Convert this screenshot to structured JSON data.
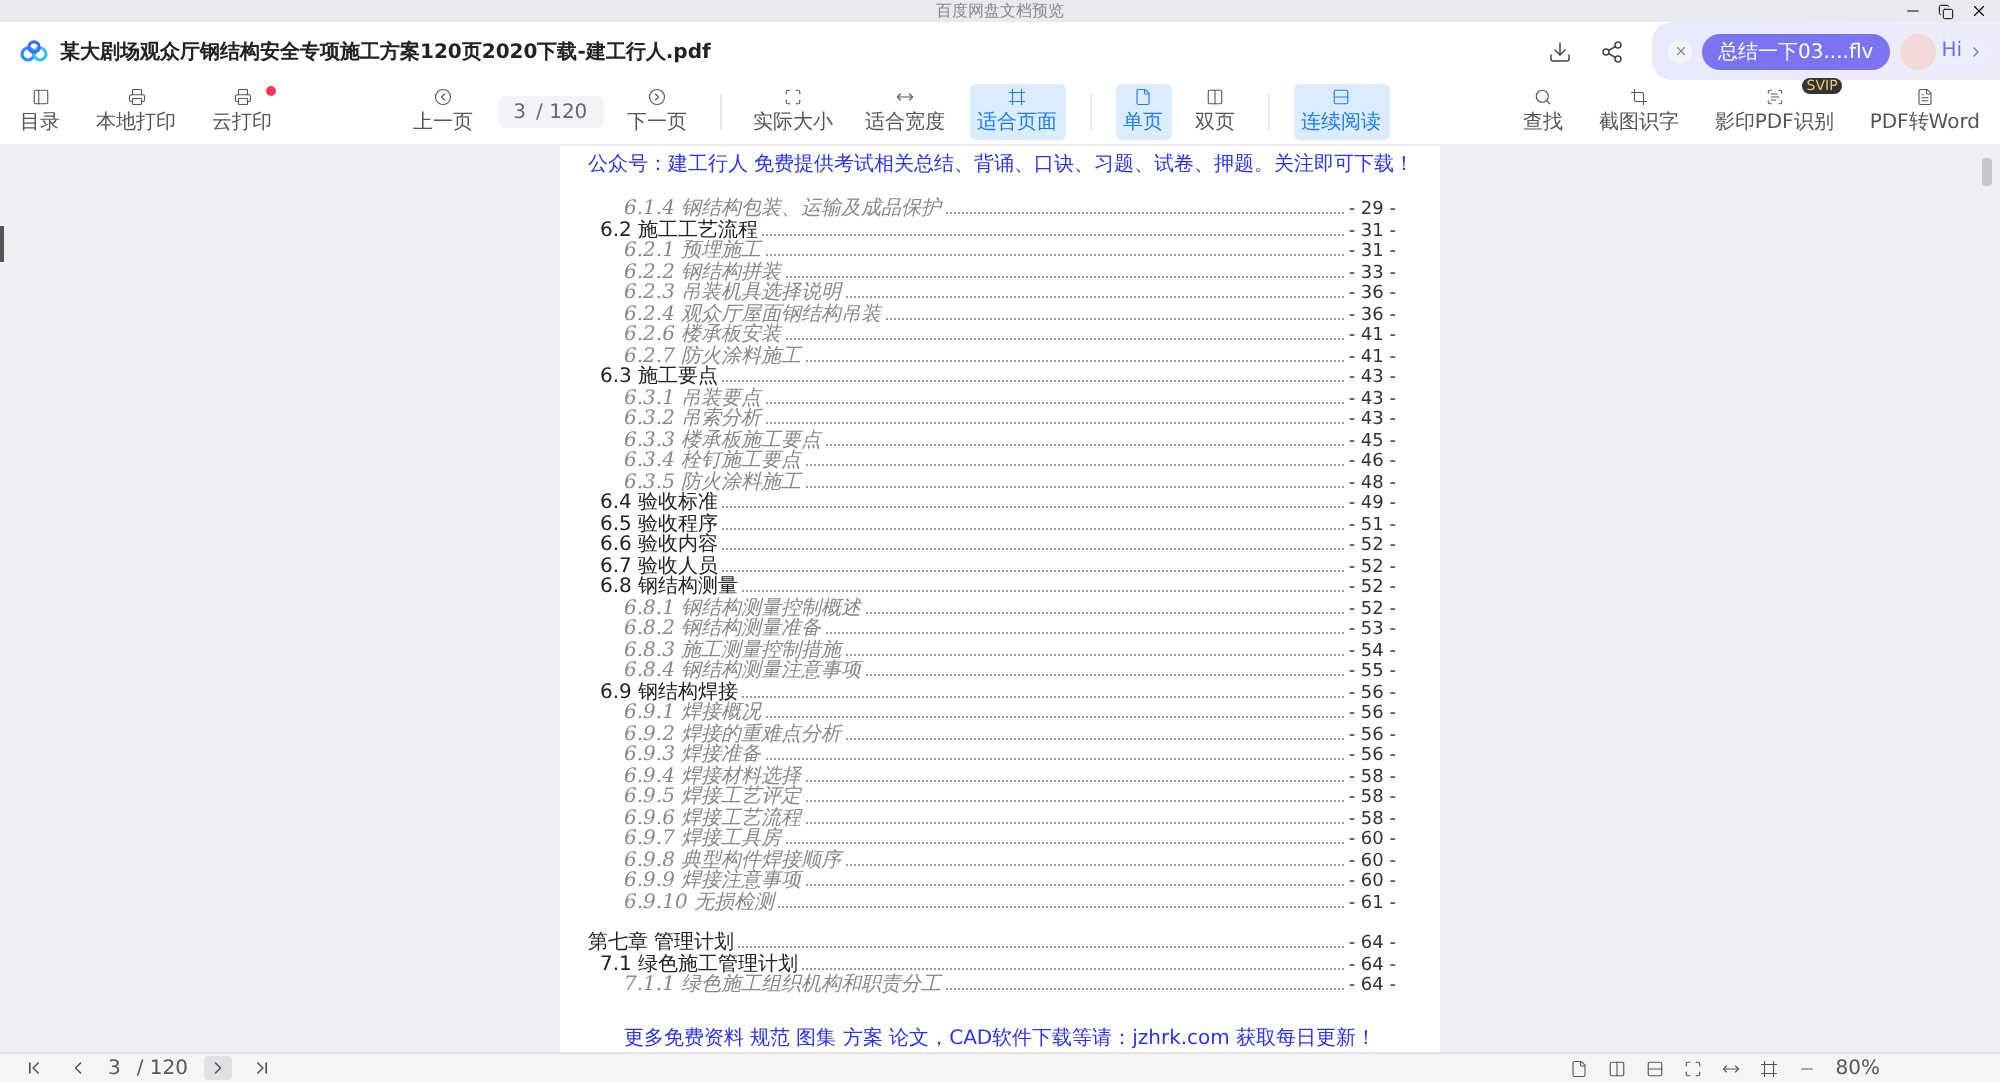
{
  "window": {
    "title": "百度网盘文档预览"
  },
  "file": {
    "name": "某大剧场观众厅钢结构安全专项施工方案120页2020下载-建工行人.pdf"
  },
  "assistant": {
    "suggestion": "总结一下03....flv",
    "greeting": "Hi"
  },
  "toolbar_left": [
    {
      "label": "目录",
      "notification": false
    },
    {
      "label": "本地打印",
      "notification": false
    },
    {
      "label": "云打印",
      "notification": true
    }
  ],
  "page_nav": {
    "previous": "上一页",
    "current": "3",
    "total": "/ 120",
    "next": "下一页"
  },
  "view_buttons": [
    {
      "label": "实际大小",
      "selected": false
    },
    {
      "label": "适合宽度",
      "selected": false
    },
    {
      "label": "适合页面",
      "selected": true
    },
    {
      "label": "单页",
      "selected": true
    },
    {
      "label": "双页",
      "selected": false
    },
    {
      "label": "连续阅读",
      "selected": true
    }
  ],
  "tools_right": [
    {
      "label": "查找"
    },
    {
      "label": "截图识字"
    },
    {
      "label": "影印PDF识别",
      "badge": "SVIP"
    },
    {
      "label": "PDF转Word"
    }
  ],
  "document": {
    "header_note": "公众号：建工行人 免费提供考试相关总结、背诵、口诀、习题、试卷、押题。关注即可下载！",
    "toc": [
      {
        "kind": "subsection",
        "number": "6.1.4",
        "title": "钢结构包装、运输及成品保护",
        "page": "- 29 -"
      },
      {
        "kind": "section",
        "number": "6.2",
        "title": "施工工艺流程",
        "page": "- 31 -",
        "children": [
          {
            "kind": "subsection",
            "number": "6.2.1",
            "title": "预埋施工",
            "page": "- 31 -"
          },
          {
            "kind": "subsection",
            "number": "6.2.2",
            "title": "钢结构拼装",
            "page": "- 33 -"
          },
          {
            "kind": "subsection",
            "number": "6.2.3",
            "title": "吊装机具选择说明",
            "page": "- 36 -"
          },
          {
            "kind": "subsection",
            "number": "6.2.4",
            "title": "观众厅屋面钢结构吊装",
            "page": "- 36 -"
          },
          {
            "kind": "subsection",
            "number": "6.2.6",
            "title": "楼承板安装",
            "page": "- 41 -"
          },
          {
            "kind": "subsection",
            "number": "6.2.7",
            "title": "防火涂料施工",
            "page": "- 41 -"
          }
        ]
      },
      {
        "kind": "section",
        "number": "6.3",
        "title": "施工要点",
        "page": "- 43 -",
        "children": [
          {
            "kind": "subsection",
            "number": "6.3.1",
            "title": "吊装要点",
            "page": "- 43 -"
          },
          {
            "kind": "subsection",
            "number": "6.3.2",
            "title": "吊索分析",
            "page": "- 43 -"
          },
          {
            "kind": "subsection",
            "number": "6.3.3",
            "title": "楼承板施工要点",
            "page": "- 45 -"
          },
          {
            "kind": "subsection",
            "number": "6.3.4",
            "title": "栓钉施工要点",
            "page": "- 46 -"
          },
          {
            "kind": "subsection",
            "number": "6.3.5",
            "title": "防火涂料施工",
            "page": "- 48 -"
          }
        ]
      },
      {
        "kind": "section",
        "number": "6.4",
        "title": "验收标准",
        "page": "- 49 -"
      },
      {
        "kind": "section",
        "number": "6.5",
        "title": "验收程序",
        "page": "- 51 -"
      },
      {
        "kind": "section",
        "number": "6.6",
        "title": "验收内容",
        "page": "- 52 -"
      },
      {
        "kind": "section",
        "number": "6.7",
        "title": "验收人员",
        "page": "- 52 -"
      },
      {
        "kind": "section",
        "number": "6.8",
        "title": "钢结构测量",
        "page": "- 52 -",
        "children": [
          {
            "kind": "subsection",
            "number": "6.8.1",
            "title": "钢结构测量控制概述",
            "page": "- 52 -"
          },
          {
            "kind": "subsection",
            "number": "6.8.2",
            "title": "钢结构测量准备",
            "page": "- 53 -"
          },
          {
            "kind": "subsection",
            "number": "6.8.3",
            "title": "施工测量控制措施",
            "page": "- 54 -"
          },
          {
            "kind": "subsection",
            "number": "6.8.4",
            "title": "钢结构测量注意事项",
            "page": "- 55 -"
          }
        ]
      },
      {
        "kind": "section",
        "number": "6.9",
        "title": "钢结构焊接",
        "page": "- 56 -",
        "children": [
          {
            "kind": "subsection",
            "number": "6.9.1",
            "title": "焊接概况",
            "page": "- 56 -"
          },
          {
            "kind": "subsection",
            "number": "6.9.2",
            "title": "焊接的重难点分析",
            "page": "- 56 -"
          },
          {
            "kind": "subsection",
            "number": "6.9.3",
            "title": "焊接准备",
            "page": "- 56 -"
          },
          {
            "kind": "subsection",
            "number": "6.9.4",
            "title": "焊接材料选择",
            "page": "- 58 -"
          },
          {
            "kind": "subsection",
            "number": "6.9.5",
            "title": "焊接工艺评定",
            "page": "- 58 -"
          },
          {
            "kind": "subsection",
            "number": "6.9.6",
            "title": "焊接工艺流程",
            "page": "- 58 -"
          },
          {
            "kind": "subsection",
            "number": "6.9.7",
            "title": "焊接工具房",
            "page": "- 60 -"
          },
          {
            "kind": "subsection",
            "number": "6.9.8",
            "title": "典型构件焊接顺序",
            "page": "- 60 -"
          },
          {
            "kind": "subsection",
            "number": "6.9.9",
            "title": "焊接注意事项",
            "page": "- 60 -"
          },
          {
            "kind": "subsection",
            "number": "6.9.10",
            "title": "无损检测",
            "page": "- 61 -"
          }
        ]
      },
      {
        "kind": "chapter",
        "number": "第七章",
        "title": "管理计划",
        "page": "- 64 -",
        "children": [
          {
            "kind": "section",
            "number": "7.1",
            "title": "绿色施工管理计划",
            "page": "- 64 -",
            "children": [
              {
                "kind": "subsection",
                "number": "7.1.1",
                "title": "绿色施工组织机构和职责分工",
                "page": "- 64 -"
              }
            ]
          }
        ]
      }
    ],
    "footer_note": "更多免费资料 规范 图集 方案 论文，CAD软件下载等请：jzhrk.com 获取每日更新！"
  },
  "bottom_bar": {
    "current": "3",
    "total": "/ 120",
    "zoom": "80%"
  }
}
